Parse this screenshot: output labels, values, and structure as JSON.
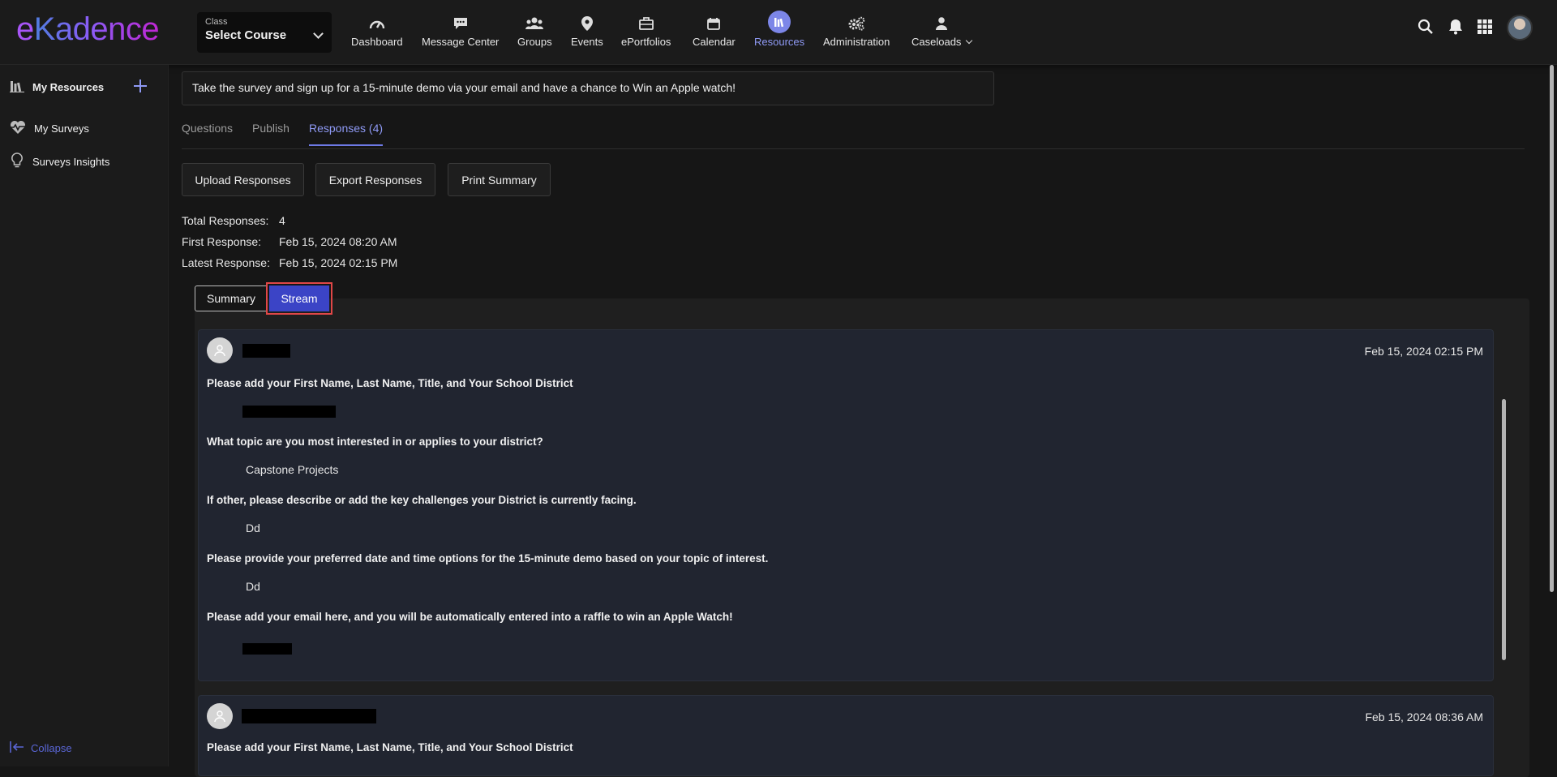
{
  "brand": {
    "e": "e",
    "rest": "Kadence"
  },
  "class_select": {
    "label": "Class",
    "value": "Select Course"
  },
  "nav": [
    {
      "label": "Dashboard",
      "icon": "gauge-icon"
    },
    {
      "label": "Message Center",
      "icon": "chat-icon"
    },
    {
      "label": "Groups",
      "icon": "users-icon"
    },
    {
      "label": "Events",
      "icon": "map-pin-icon"
    },
    {
      "label": "ePortfolios",
      "icon": "briefcase-icon"
    },
    {
      "label": "Calendar",
      "icon": "calendar-icon"
    },
    {
      "label": "Resources",
      "icon": "library-icon",
      "active": true
    },
    {
      "label": "Administration",
      "icon": "cogs-icon"
    },
    {
      "label": "Caseloads",
      "icon": "person-icon"
    }
  ],
  "sidebar": {
    "items": [
      {
        "label": "My Resources",
        "icon": "library-icon"
      },
      {
        "label": "My Surveys",
        "icon": "heartbeat-icon"
      },
      {
        "label": "Surveys Insights",
        "icon": "lightbulb-icon"
      }
    ],
    "collapse_label": "Collapse"
  },
  "main": {
    "banner": "Take the survey and sign up for a 15-minute demo via your email and have a chance to Win an Apple watch!",
    "tabs": [
      "Questions",
      "Publish",
      "Responses (4)"
    ],
    "buttons": [
      "Upload Responses",
      "Export Responses",
      "Print Summary"
    ],
    "stats": [
      {
        "label": "Total Responses:",
        "value": "4"
      },
      {
        "label": "First Response:",
        "value": "Feb 15, 2024 08:20 AM"
      },
      {
        "label": "Latest Response:",
        "value": "Feb 15, 2024 02:15 PM"
      }
    ],
    "view_toggle": {
      "summary": "Summary",
      "stream": "Stream"
    },
    "responses": [
      {
        "date": "Feb 15, 2024 02:15 PM",
        "items": [
          {
            "q": "Please add your First Name, Last Name, Title, and Your School District",
            "a": ""
          },
          {
            "q": "What topic are you most interested in or applies to your district?",
            "a": "Capstone Projects"
          },
          {
            "q": "If other, please describe or add the key challenges your District is currently facing.",
            "a": "Dd"
          },
          {
            "q": "Please provide your preferred date and time options for the 15-minute demo based on your topic of interest.",
            "a": "Dd"
          },
          {
            "q": "Please add your email here, and you will be automatically entered into a raffle to win an Apple Watch!",
            "a": ""
          }
        ]
      },
      {
        "date": "Feb 15, 2024 08:36 AM",
        "items": [
          {
            "q": "Please add your First Name, Last Name, Title, and Your School District",
            "a": ""
          }
        ]
      }
    ]
  }
}
